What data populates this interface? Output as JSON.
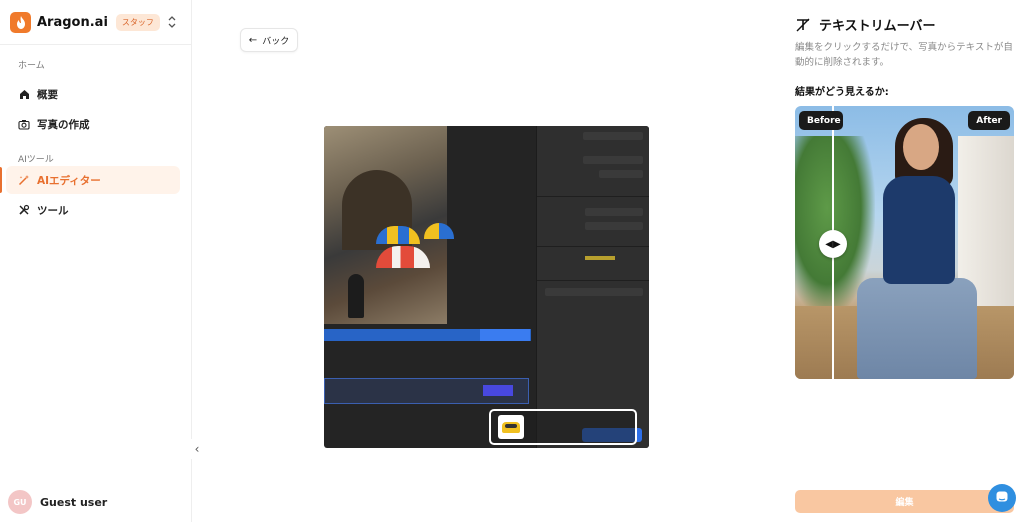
{
  "brand": {
    "name": "Aragon.ai",
    "badge": "スタッフ",
    "accent": "#f07a2b"
  },
  "sidebar": {
    "sections": [
      {
        "label": "ホーム"
      },
      {
        "label": "AIツール"
      }
    ],
    "items": [
      {
        "label": "概要",
        "icon": "home-icon"
      },
      {
        "label": "写真の作成",
        "icon": "camera-icon"
      },
      {
        "label": "AIエディター",
        "icon": "magic-wand-icon",
        "active": true
      },
      {
        "label": "ツール",
        "icon": "tools-icon"
      }
    ],
    "collapse_glyph": "‹"
  },
  "user": {
    "initials": "GU",
    "name": "Guest user"
  },
  "main": {
    "back_label": "バック",
    "back_glyph": "←"
  },
  "tool": {
    "title": "テキストリムーバー",
    "description": "編集をクリックするだけで、写真からテキストが自動的に削除されます。",
    "result_label": "結果がどう見えるか:",
    "before_label": "Before",
    "after_label": "After",
    "handle_glyph": "◀▶",
    "edit_label": "編集",
    "edit_color": "#f9c7a1"
  },
  "chat": {
    "icon": "chat-icon",
    "color": "#2f8fe0"
  }
}
